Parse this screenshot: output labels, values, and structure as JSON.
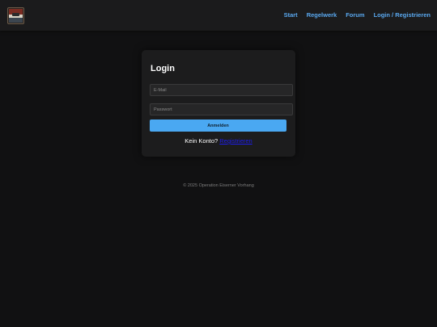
{
  "header": {
    "logo_alt": "Operation Eiserner Vorhang logo",
    "nav": [
      {
        "label": "Start"
      },
      {
        "label": "Regelwerk"
      },
      {
        "label": "Forum"
      },
      {
        "label": "Login / Registrieren"
      }
    ]
  },
  "login": {
    "title": "Login",
    "email_placeholder": "E-Mail",
    "password_placeholder": "Passwort",
    "submit_label": "Anmelden",
    "no_account_text": "Kein Konto?",
    "register_link": "Registrieren"
  },
  "footer": {
    "copyright": "© 2025 Operation Eiserner Vorhang"
  },
  "colors": {
    "background": "#111112",
    "header": "#1b1b1c",
    "card": "#1c1c1d",
    "accent": "#4aa8f2",
    "nav_link": "#5aa9f0"
  }
}
